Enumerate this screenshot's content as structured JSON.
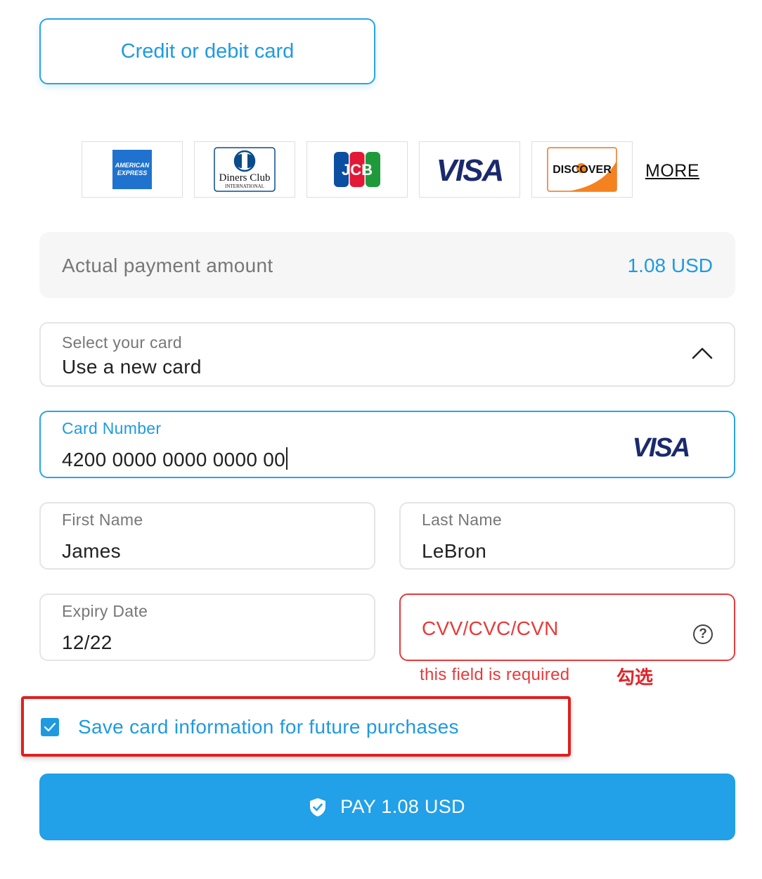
{
  "payment_method": {
    "tab_label": "Credit or debit card"
  },
  "brands": {
    "items": [
      {
        "name": "American Express",
        "logo_text_1": "AMERICAN",
        "logo_text_2": "EXPRESS"
      },
      {
        "name": "Diners Club",
        "logo_text_1": "Diners Club",
        "logo_text_2": "INTERNATIONAL"
      },
      {
        "name": "JCB",
        "logo_text_1": "JCB"
      },
      {
        "name": "Visa",
        "logo_text_1": "VISA"
      },
      {
        "name": "Discover",
        "logo_text_1": "DISCOVER"
      }
    ],
    "more_label": "MORE"
  },
  "amount": {
    "label": "Actual payment amount",
    "value": "1.08 USD"
  },
  "select_card": {
    "label": "Select your card",
    "value": "Use a new card"
  },
  "card_number": {
    "label": "Card Number",
    "value": "4200 0000 0000 0000 00",
    "brand": "VISA"
  },
  "first_name": {
    "label": "First Name",
    "value": "James"
  },
  "last_name": {
    "label": "Last Name",
    "value": "LeBron"
  },
  "expiry": {
    "label": "Expiry Date",
    "value": "12/22"
  },
  "cvv": {
    "placeholder": "CVV/CVC/CVN",
    "help_glyph": "?",
    "error": "this field is required"
  },
  "annotation": {
    "text": "勾选"
  },
  "save_card": {
    "label": "Save card information for future purchases",
    "checked": true
  },
  "pay_button": {
    "label": "PAY 1.08 USD"
  },
  "colors": {
    "accent": "#1f9ae0",
    "error": "#e63b3b",
    "annotation": "#e01f1f"
  }
}
